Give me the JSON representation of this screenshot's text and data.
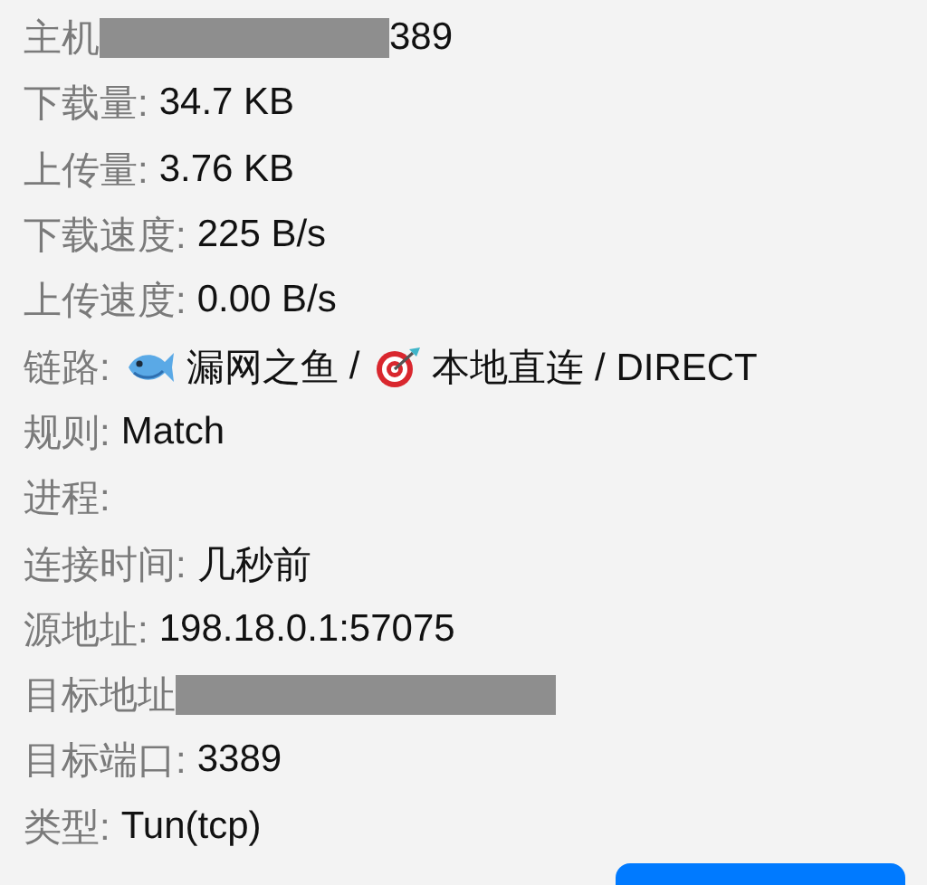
{
  "rows": [
    {
      "kind": "redacted",
      "label": "主机",
      "value": "389"
    },
    {
      "kind": "text",
      "label": "下载量:",
      "value": "34.7 KB"
    },
    {
      "kind": "text",
      "label": "上传量:",
      "value": "3.76 KB"
    },
    {
      "kind": "text",
      "label": "下载速度:",
      "value": "225 B/s"
    },
    {
      "kind": "text",
      "label": "上传速度:",
      "value": "0.00 B/s"
    },
    {
      "kind": "chain",
      "label": "链路:",
      "segments": [
        "漏网之鱼",
        "/",
        "本地直连 / DIRECT"
      ]
    },
    {
      "kind": "text",
      "label": "规则:",
      "value": "Match"
    },
    {
      "kind": "text",
      "label": "进程:"
    },
    {
      "kind": "text",
      "label": "连接时间:",
      "value": "几秒前"
    },
    {
      "kind": "text",
      "label": "源地址:",
      "value": "198.18.0.1:57075"
    },
    {
      "kind": "redacted",
      "label": "目标地址"
    },
    {
      "kind": "text",
      "label": "目标端口:",
      "value": "3389"
    },
    {
      "kind": "text",
      "label": "类型:",
      "value": "Tun(tcp)"
    }
  ]
}
